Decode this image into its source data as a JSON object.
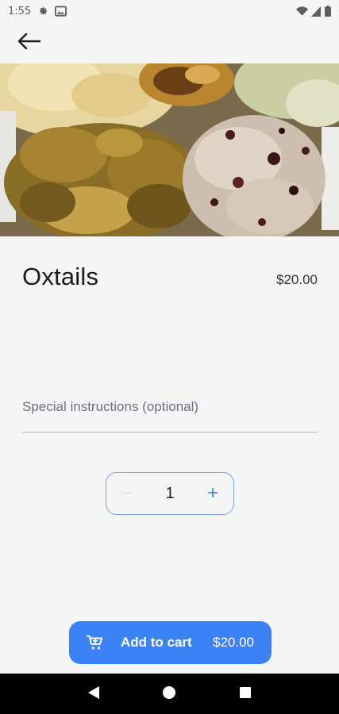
{
  "status_bar": {
    "time": "1:55",
    "icons": [
      "settings-icon",
      "image-icon",
      "wifi-icon",
      "signal-icon",
      "battery-icon"
    ]
  },
  "app_bar": {
    "back_icon": "arrow-left-icon"
  },
  "hero_image": {
    "alt": "food-photo"
  },
  "item": {
    "title": "Oxtails",
    "price": "$20.00"
  },
  "instructions": {
    "placeholder": "Special instructions (optional)"
  },
  "quantity": {
    "value": "1",
    "minus": "−",
    "plus": "+"
  },
  "cart_button": {
    "label": "Add to cart",
    "total": "$20.00",
    "icon": "cart-icon"
  },
  "nav": {
    "back": "nav-back-icon",
    "home": "nav-home-icon",
    "recents": "nav-recents-icon"
  },
  "colors": {
    "accent": "#3b82f6",
    "background": "#f5f5f5",
    "nav": "#000000"
  }
}
